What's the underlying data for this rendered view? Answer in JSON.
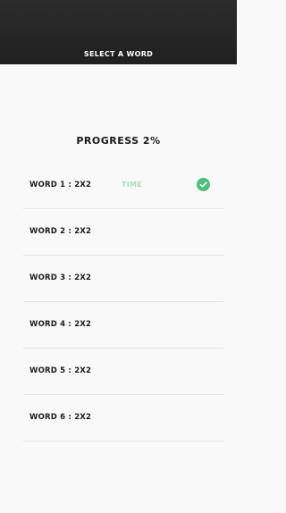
{
  "header": {
    "title": "SELECT A WORD"
  },
  "progress": {
    "label": "PROGRESS 2%"
  },
  "words": [
    {
      "label": "WORD 1 : 2X2",
      "time": "TIME",
      "completed": true
    },
    {
      "label": "WORD 2 : 2X2",
      "time": "",
      "completed": false
    },
    {
      "label": "WORD 3 : 2X2",
      "time": "",
      "completed": false
    },
    {
      "label": "WORD 4 : 2X2",
      "time": "",
      "completed": false
    },
    {
      "label": "WORD 5 : 2X2",
      "time": "",
      "completed": false
    },
    {
      "label": "WORD 6 : 2X2",
      "time": "",
      "completed": false
    }
  ],
  "colors": {
    "header": "#242424",
    "time": "#a8dcc0",
    "check": "#4dc17c"
  },
  "icons": {
    "completed": "check-circle-icon"
  }
}
